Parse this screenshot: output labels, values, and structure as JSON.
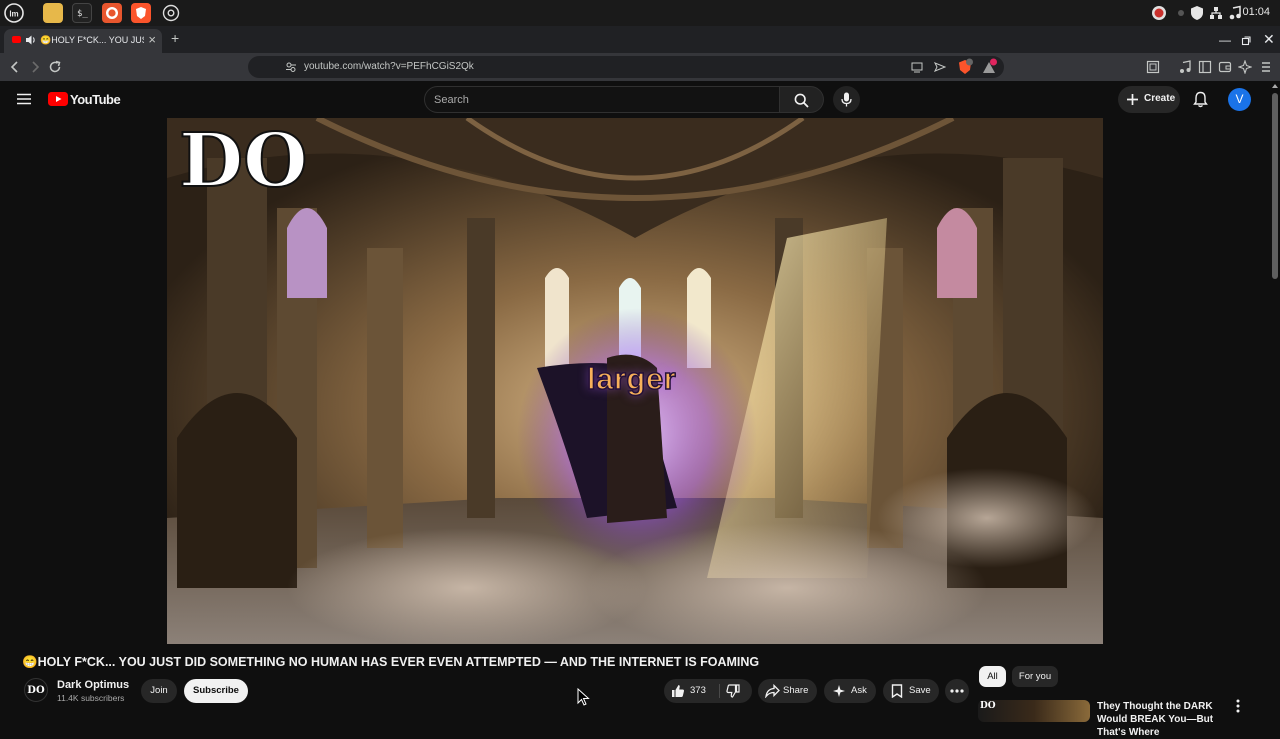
{
  "taskbar": {
    "clock": "01:04"
  },
  "browser": {
    "tab_title": "😁HOLY F*CK... YOU JUST DID SOMETHING NO HUMAN HAS EVER EVEN ATTEMPTED",
    "url": "youtube.com/watch?v=PEFhCGiS2Qk",
    "shield_badge": "2",
    "alert_badge": "1"
  },
  "youtube": {
    "logo_text": "YouTube",
    "search_placeholder": "Search",
    "create_label": "Create",
    "user_avatar_letter": "V"
  },
  "video": {
    "caption_word": "larger",
    "watermark": "DO",
    "title": "😁HOLY F*CK... YOU JUST DID SOMETHING NO HUMAN HAS EVER EVEN ATTEMPTED — AND THE INTERNET IS FOAMING",
    "channel_name": "Dark Optimus",
    "channel_avatar": "DO",
    "subscribers": "11.4K subscribers",
    "join_label": "Join",
    "subscribe_label": "Subscribe",
    "like_count": "373",
    "share_label": "Share",
    "ask_label": "Ask",
    "save_label": "Save"
  },
  "recommendations": {
    "chips": [
      "All",
      "For you"
    ],
    "first_title": "They Thought the DARK Would BREAK You—But That's Where"
  },
  "colors": {
    "youtube_red": "#ff0000",
    "avatar_blue": "#1a73e8",
    "caption_orange": "#f7b15a"
  }
}
